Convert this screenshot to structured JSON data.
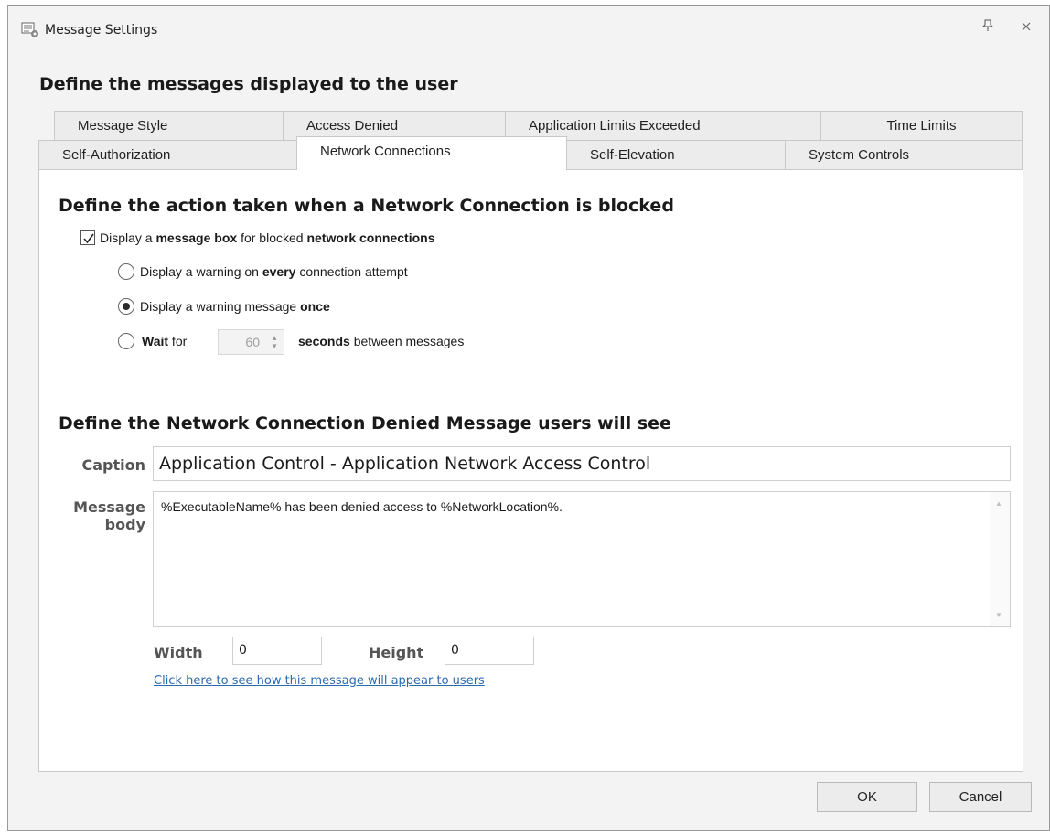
{
  "window": {
    "title": "Message Settings",
    "icon": "message-settings-icon",
    "pin_icon": "pin-icon",
    "close_icon": "close-icon"
  },
  "heading": "Define the messages displayed to the user",
  "tabs_row1": [
    {
      "label": "Message Style"
    },
    {
      "label": "Access Denied"
    },
    {
      "label": "Application Limits Exceeded"
    },
    {
      "label": "Time Limits"
    }
  ],
  "tabs_row2": [
    {
      "label": "Self-Authorization"
    },
    {
      "label": "Network Connections",
      "active": true
    },
    {
      "label": "Self-Elevation"
    },
    {
      "label": "System Controls"
    }
  ],
  "action_section": {
    "heading": "Define the action taken when a Network Connection is blocked",
    "checkbox": {
      "checked": true,
      "parts": [
        "Display a ",
        "message box",
        " for blocked ",
        "network connections"
      ]
    },
    "radio_every": {
      "selected": false,
      "parts": [
        "Display a warning on ",
        "every",
        " connection attempt"
      ]
    },
    "radio_once": {
      "selected": true,
      "parts": [
        "Display a warning message ",
        "once"
      ]
    },
    "radio_wait": {
      "selected": false,
      "parts": [
        "Wait",
        " for"
      ],
      "seconds_value": "60",
      "suffix_parts": [
        "seconds",
        " between messages"
      ]
    }
  },
  "message_section": {
    "heading": "Define the Network Connection Denied Message users will see",
    "caption_label": "Caption",
    "caption_value": "Application Control - Application Network Access Control",
    "body_label_1": "Message",
    "body_label_2": "body",
    "body_value": "%ExecutableName% has been denied access to %NetworkLocation%.",
    "width_label": "Width",
    "width_value": "0",
    "height_label": "Height",
    "height_value": "0",
    "preview_link": "Click here to see how this message will appear to users"
  },
  "buttons": {
    "ok": "OK",
    "cancel": "Cancel"
  }
}
